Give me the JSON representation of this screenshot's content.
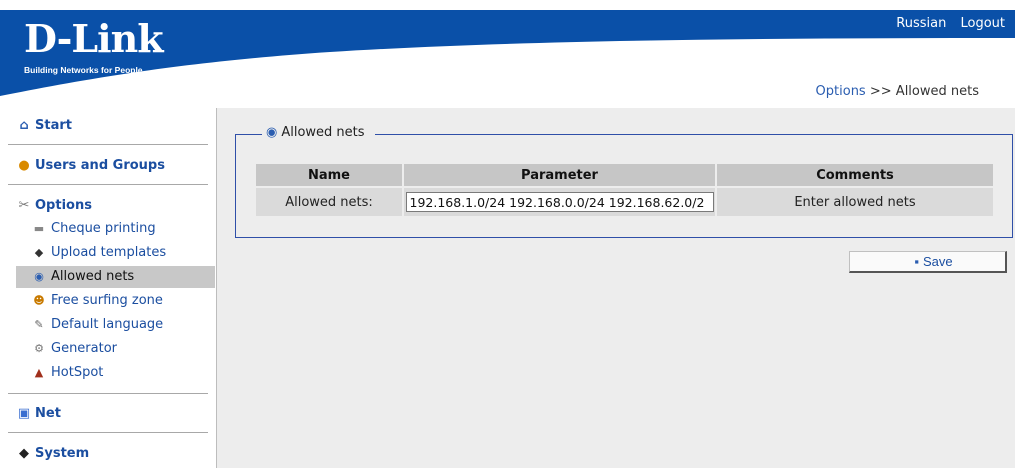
{
  "header": {
    "logo": "D-Link",
    "tagline": "Building Networks for People",
    "links": [
      "Russian",
      "Logout"
    ],
    "breadcrumb": {
      "parent": "Options",
      "separator": ">>",
      "current": "Allowed nets"
    }
  },
  "sidebar": {
    "sections": [
      {
        "label": "Start",
        "icon": "home-icon"
      },
      {
        "label": "Users and Groups",
        "icon": "user-icon"
      },
      {
        "label": "Options",
        "icon": "tools-icon"
      },
      {
        "label": "Net",
        "icon": "computer-icon"
      },
      {
        "label": "System",
        "icon": "chip-icon"
      }
    ],
    "options_items": [
      {
        "label": "Cheque printing",
        "icon": "printer-icon"
      },
      {
        "label": "Upload templates",
        "icon": "template-icon"
      },
      {
        "label": "Allowed nets",
        "icon": "globe-icon",
        "active": true
      },
      {
        "label": "Free surfing zone",
        "icon": "surfer-icon"
      },
      {
        "label": "Default language",
        "icon": "language-icon"
      },
      {
        "label": "Generator",
        "icon": "generator-icon"
      },
      {
        "label": "HotSpot",
        "icon": "hotspot-icon"
      }
    ]
  },
  "panel": {
    "legend": "Allowed nets",
    "columns": [
      "Name",
      "Parameter",
      "Comments"
    ],
    "row": {
      "name": "Allowed nets:",
      "value": "192.168.1.0/24 192.168.0.0/24 192.168.62.0/2",
      "comment": "Enter allowed nets"
    },
    "save_label": "Save"
  },
  "colors": {
    "header_blue": "#0a50a8",
    "link_blue": "#1b4ea0",
    "panel_border": "#2f4fa8",
    "active_item": "#c8c8c8"
  }
}
